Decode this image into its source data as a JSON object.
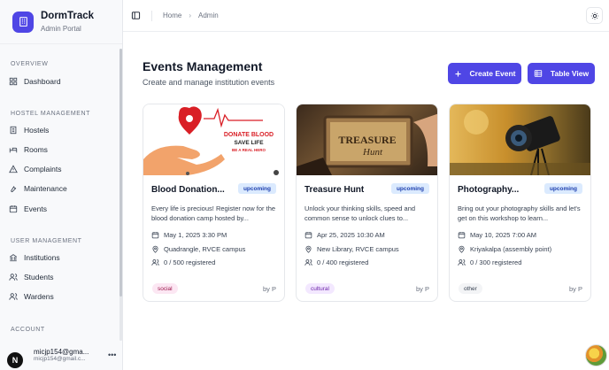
{
  "brand": {
    "name": "DormTrack",
    "subtitle": "Admin Portal"
  },
  "sidebar": {
    "sections": [
      {
        "label": "OVERVIEW",
        "items": [
          {
            "label": "Dashboard",
            "icon": "dashboard-icon"
          }
        ]
      },
      {
        "label": "HOSTEL MANAGEMENT",
        "items": [
          {
            "label": "Hostels",
            "icon": "building-icon"
          },
          {
            "label": "Rooms",
            "icon": "bed-icon"
          },
          {
            "label": "Complaints",
            "icon": "alert-triangle-icon"
          },
          {
            "label": "Maintenance",
            "icon": "wrench-icon"
          },
          {
            "label": "Events",
            "icon": "calendar-icon"
          }
        ]
      },
      {
        "label": "USER MANAGEMENT",
        "items": [
          {
            "label": "Institutions",
            "icon": "institution-icon"
          },
          {
            "label": "Students",
            "icon": "users-icon"
          },
          {
            "label": "Wardens",
            "icon": "users-icon"
          }
        ]
      },
      {
        "label": "ACCOUNT",
        "items": []
      }
    ],
    "user": {
      "name": "micjp154@gma...",
      "email": "micjp154@gmail.c...",
      "avatar_letter": "N"
    }
  },
  "breadcrumb": {
    "home": "Home",
    "current": "Admin"
  },
  "main": {
    "title": "Events Management",
    "subtitle": "Create and manage institution events",
    "create_label": "Create Event",
    "view_label": "Table View"
  },
  "events": [
    {
      "title": "Blood Donation...",
      "status": "upcoming",
      "description": "Every life is precious! Register now for the blood donation camp hosted by...",
      "date": "May 1, 2025 3:30 PM",
      "location": "Quadrangle, RVCE campus",
      "registered": "0 / 500 registered",
      "category": "social",
      "by": "by P",
      "image_text": [
        "DONATE BLOOD",
        "SAVE LIFE",
        "BE A REAL HERO"
      ]
    },
    {
      "title": "Treasure Hunt",
      "status": "upcoming",
      "description": "Unlock your thinking skills, speed and common sense to unlock clues to...",
      "date": "Apr 25, 2025 10:30 AM",
      "location": "New Library, RVCE campus",
      "registered": "0 / 400 registered",
      "category": "cultural",
      "by": "by P",
      "image_text": [
        "TREASURE",
        "Hunt"
      ]
    },
    {
      "title": "Photography...",
      "status": "upcoming",
      "description": "Bring out your photography skills and let's get on this workshop to learn...",
      "date": "May 10, 2025 7:00 AM",
      "location": "Kriyakalpa (assembly point)",
      "registered": "0 / 300 registered",
      "category": "other",
      "by": "by P"
    }
  ],
  "colors": {
    "accent": "#4f46e5",
    "badge_bg": "#dbeafe",
    "social": "#fce7f3",
    "cultural": "#f3e8ff",
    "other": "#f3f4f6"
  }
}
